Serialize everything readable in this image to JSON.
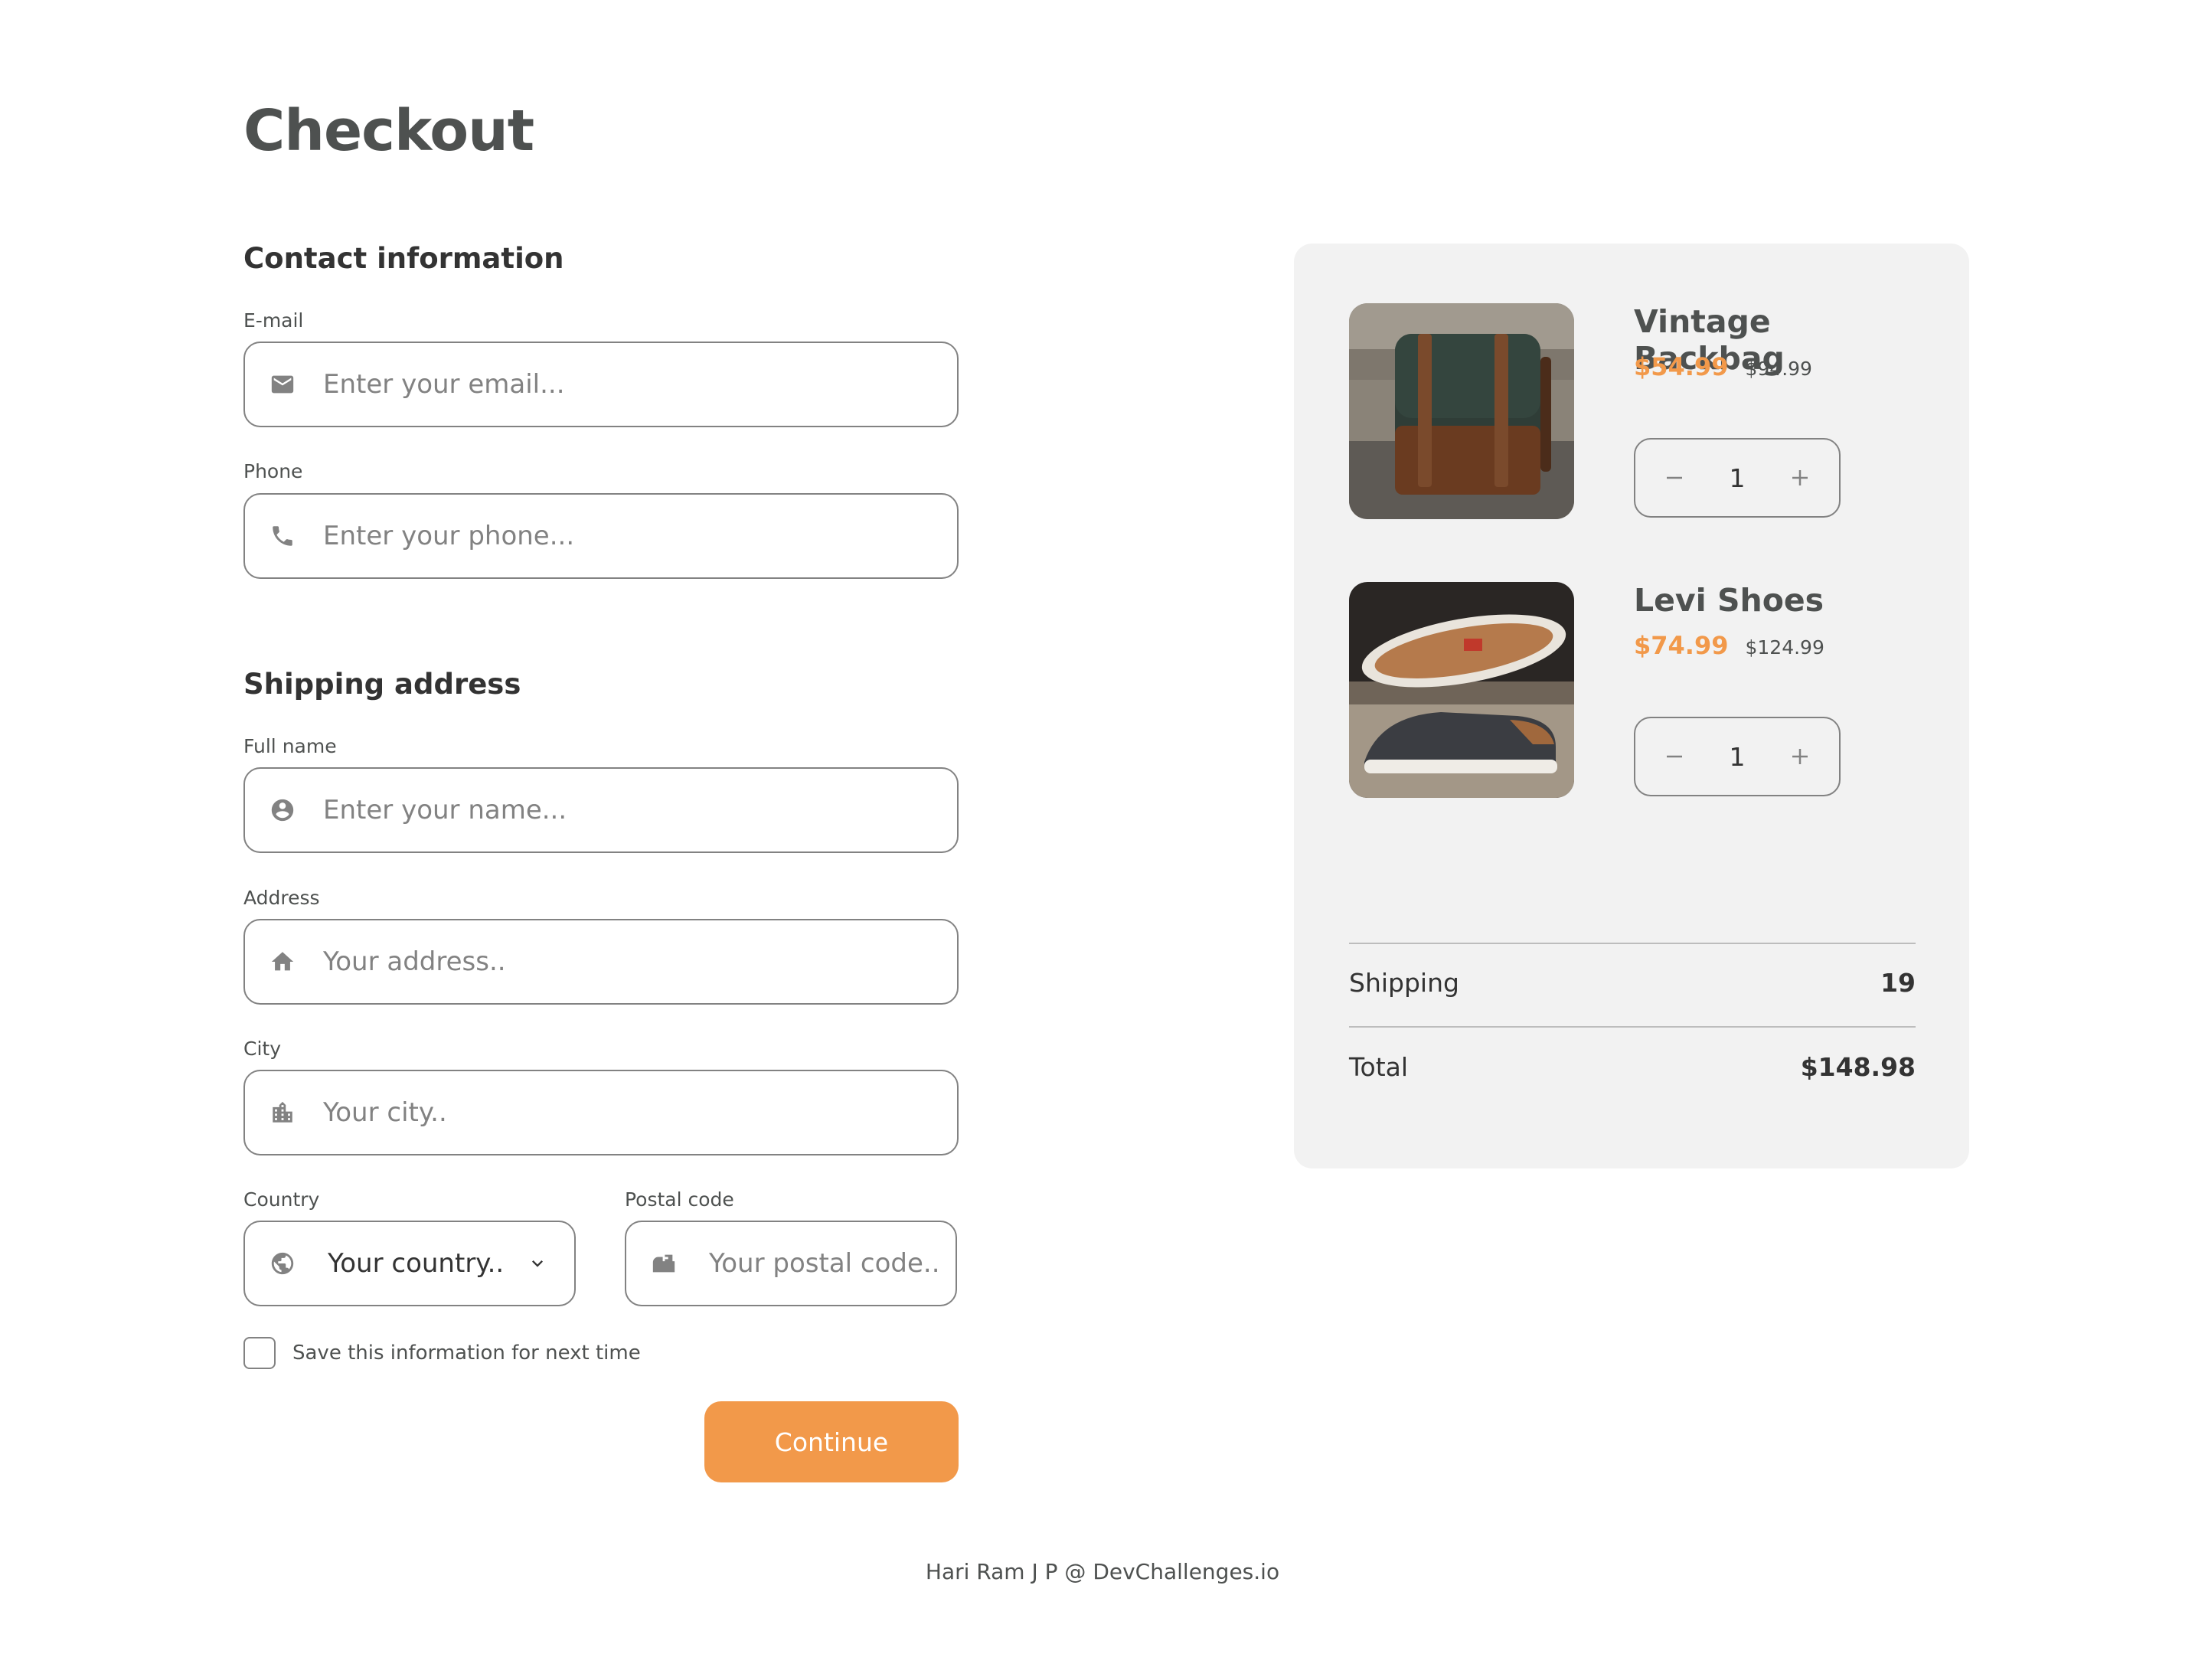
{
  "page": {
    "title": "Checkout"
  },
  "contact": {
    "section_title": "Contact information",
    "email": {
      "label": "E-mail",
      "placeholder": "Enter your email...",
      "icon": "mail-icon"
    },
    "phone": {
      "label": "Phone",
      "placeholder": "Enter your phone...",
      "icon": "phone-icon"
    }
  },
  "shipping": {
    "section_title": "Shipping address",
    "full_name": {
      "label": "Full name",
      "placeholder": "Enter your name...",
      "icon": "account-circle-icon"
    },
    "address": {
      "label": "Address",
      "placeholder": "Your address..",
      "icon": "home-icon"
    },
    "city": {
      "label": "City",
      "placeholder": "Your city..",
      "icon": "city-icon"
    },
    "country": {
      "label": "Country",
      "value": "Your country..",
      "icon": "globe-icon"
    },
    "postal": {
      "label": "Postal code",
      "placeholder": "Your postal code..",
      "icon": "mailbox-icon"
    },
    "save_info_label": "Save this information for next time",
    "continue_label": "Continue"
  },
  "cart": {
    "items": [
      {
        "name": "Vintage Backbag",
        "price": "$54.99",
        "old_price": "$94.99",
        "quantity": "1",
        "image": "backpack-photo"
      },
      {
        "name": "Levi Shoes",
        "price": "$74.99",
        "old_price": "$124.99",
        "quantity": "1",
        "image": "shoes-photo"
      }
    ],
    "shipping_label": "Shipping",
    "shipping_value": "19",
    "total_label": "Total",
    "total_value": "$148.98"
  },
  "footer": {
    "text": "Hari Ram J P @ DevChallenges.io"
  },
  "colors": {
    "accent": "#f2994a",
    "panel_bg": "#f2f2f2",
    "border": "#828282",
    "text": "#333333"
  }
}
